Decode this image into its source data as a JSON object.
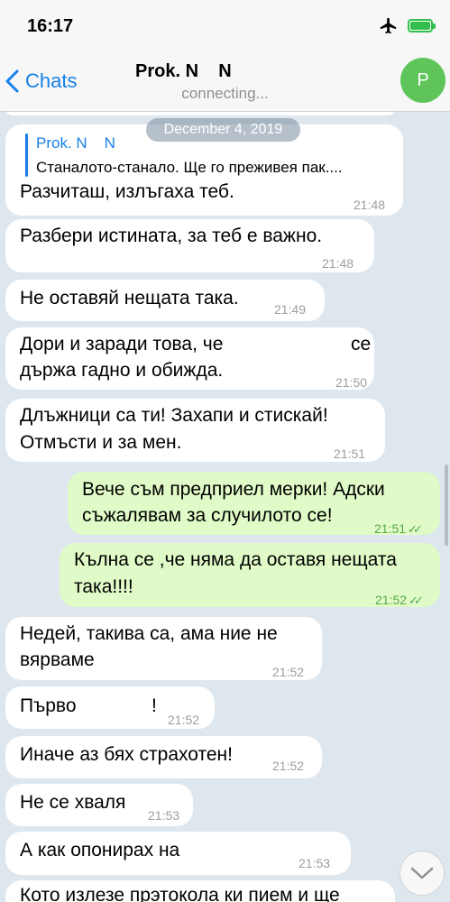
{
  "status_bar": {
    "time": "16:17"
  },
  "nav": {
    "back_label": "Chats",
    "title": "Prok. N    N",
    "status": "connecting...",
    "avatar_letter": "P"
  },
  "date_pill": "December 4, 2019",
  "messages": [
    {
      "reply_name": "Prok. N    N",
      "reply_text": "Станалото-станало. Ще го преживея пак....",
      "text": "Разчиташ, излъгаха теб.",
      "time": "21:48"
    },
    {
      "text": "Разбери истината, за теб е важно.",
      "time": "21:48"
    },
    {
      "text": "Не оставяй нещата така.",
      "time": "21:49"
    },
    {
      "line1": "Дори и заради това,  че",
      "line1_end": "се",
      "line2": "държа гадно и обижда.",
      "time": "21:50"
    },
    {
      "line1": "Длъжници са ти! Захапи и стискай!",
      "line2": "Отмъсти и за мен.",
      "time": "21:51"
    },
    {
      "line1": "Вече съм предприел мерки! Адски",
      "line2": "съжалявам за случилото се!",
      "time": "21:51"
    },
    {
      "line1": "Кълна се ,че няма да оставя нещата",
      "line2": "така!!!!",
      "time": "21:52"
    },
    {
      "line1": "Недей, такива са, ама ние не",
      "line2": "вярваме",
      "time": "21:52"
    },
    {
      "text": "Първо",
      "text_end": "!",
      "time": "21:52"
    },
    {
      "text": "Иначе аз бях страхотен!",
      "time": "21:52"
    },
    {
      "text": "Не се хваля",
      "time": "21:53"
    },
    {
      "text": "А как опонирах на",
      "time": "21:53"
    },
    {
      "text": "Кото излезе прэтокола ки пием и ще"
    }
  ],
  "colors": {
    "incoming": "#ffffff",
    "outgoing": "#e0fbc7",
    "accent": "#1680e8",
    "read_checks": "#56a84a"
  },
  "icons": [
    "airplane-icon",
    "battery-icon",
    "chevron-left-icon",
    "double-check-icon",
    "chevron-down-icon"
  ]
}
